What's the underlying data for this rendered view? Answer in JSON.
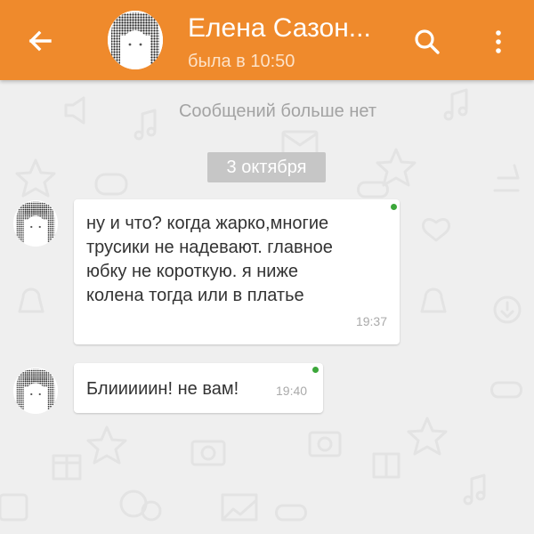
{
  "header": {
    "title": "Елена Сазон...",
    "status": "была в 10:50",
    "color": "#ef8a2c"
  },
  "icons": {
    "back": "arrow-back-icon",
    "search": "search-icon",
    "more": "more-vert-icon"
  },
  "chat": {
    "no_more_text": "Сообщений больше нет",
    "date_separator": "3 октября",
    "messages": [
      {
        "lines": [
          "ну и что? когда жарко,многие",
          "трусики не надевают. главное",
          "юбку не короткую. я ниже",
          "колена тогда или в платье"
        ],
        "time": "19:37",
        "online": true
      },
      {
        "lines": [
          "Блииииин! не вам!"
        ],
        "time": "19:40",
        "online": true
      }
    ]
  },
  "colors": {
    "online_dot": "#3ca73a",
    "background": "#efefef",
    "bubble": "#ffffff"
  }
}
